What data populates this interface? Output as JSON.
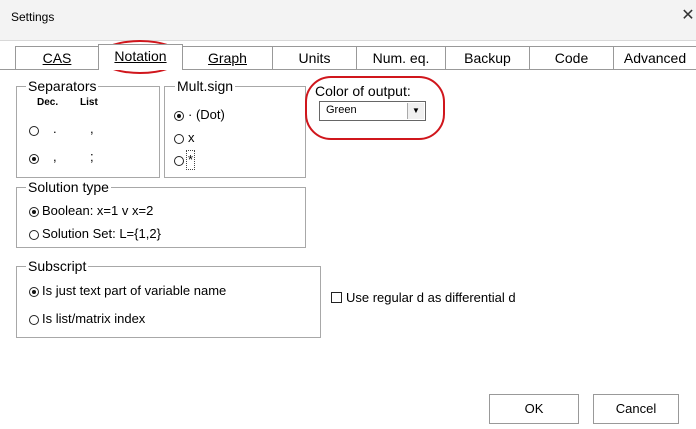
{
  "window": {
    "title": "Settings",
    "close_glyph": "✕"
  },
  "tabs": [
    {
      "label": "CAS",
      "active": false
    },
    {
      "label": "Notation",
      "active": true
    },
    {
      "label": "Graph",
      "active": false
    },
    {
      "label": "Units",
      "active": false
    },
    {
      "label": "Num. eq.",
      "active": false
    },
    {
      "label": "Backup",
      "active": false
    },
    {
      "label": "Code",
      "active": false
    },
    {
      "label": "Advanced",
      "active": false
    }
  ],
  "separators": {
    "legend": "Separators",
    "dec_header": "Dec.",
    "list_header": "List",
    "option1_dec": ".",
    "option1_list": ",",
    "option2_dec": ",",
    "option2_list": ";",
    "selected": 2
  },
  "mult_sign": {
    "legend": "Mult.sign",
    "options": [
      "· (Dot)",
      "x",
      "*"
    ],
    "selected": 0
  },
  "output_color": {
    "label": "Color of output:",
    "value": "Green"
  },
  "solution_type": {
    "legend": "Solution type",
    "options": [
      "Boolean: x=1 v x=2",
      "Solution Set: L={1,2}"
    ],
    "selected": 0
  },
  "subscript": {
    "legend": "Subscript",
    "options": [
      "Is just text part of variable name",
      "Is list/matrix index"
    ],
    "selected": 0
  },
  "differential": {
    "label": "Use regular d as differential d",
    "checked": false
  },
  "footer": {
    "ok": "OK",
    "cancel": "Cancel"
  },
  "colors": {
    "annotation_red": "#d0161c",
    "border": "#a8a8a8"
  }
}
